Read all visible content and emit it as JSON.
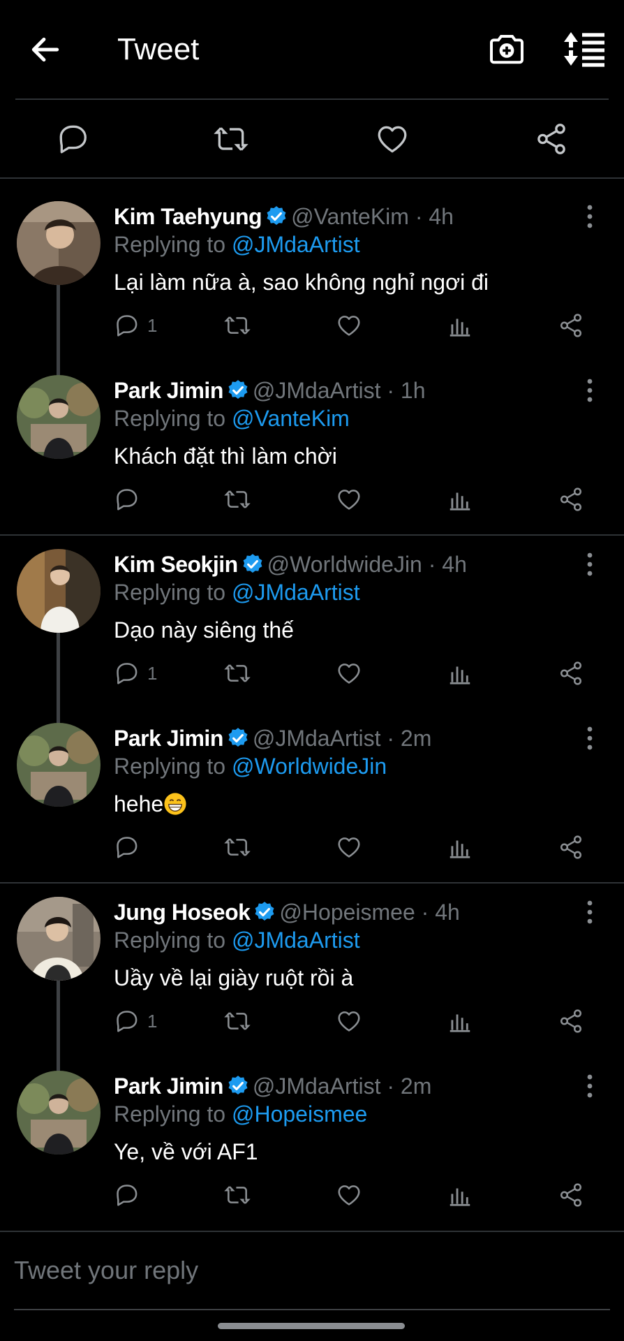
{
  "header": {
    "title": "Tweet"
  },
  "compose": {
    "placeholder": "Tweet your reply"
  },
  "colors": {
    "accent": "#1d9bf0",
    "muted": "#71767b",
    "background": "#000000"
  },
  "tweets": [
    {
      "name": "Kim Taehyung",
      "handle": "@VanteKim",
      "time": "· 4h",
      "replying_prefix": "Replying to",
      "replying_to": "@JMdaArtist",
      "text": "Lại làm nữa à, sao không nghỉ ngơi đi",
      "reply_count": "1"
    },
    {
      "name": "Park Jimin",
      "handle": "@JMdaArtist",
      "time": "· 1h",
      "replying_prefix": "Replying to",
      "replying_to": "@VanteKim",
      "text": "Khách đặt thì làm chời",
      "reply_count": ""
    },
    {
      "name": "Kim Seokjin",
      "handle": "@WorldwideJin",
      "time": "· 4h",
      "replying_prefix": "Replying to",
      "replying_to": "@JMdaArtist",
      "text": "Dạo này siêng thế",
      "reply_count": "1"
    },
    {
      "name": "Park Jimin",
      "handle": "@JMdaArtist",
      "time": "· 2m",
      "replying_prefix": "Replying to",
      "replying_to": "@WorldwideJin",
      "text": "hehe",
      "reply_count": ""
    },
    {
      "name": "Jung Hoseok",
      "handle": "@Hopeismee",
      "time": "· 4h",
      "replying_prefix": "Replying to",
      "replying_to": "@JMdaArtist",
      "text": "Uầy về lại giày ruột rồi à",
      "reply_count": "1"
    },
    {
      "name": "Park Jimin",
      "handle": "@JMdaArtist",
      "time": "· 2m",
      "replying_prefix": "Replying to",
      "replying_to": "@Hopeismee",
      "text": "Ye, về với AF1",
      "reply_count": ""
    }
  ]
}
